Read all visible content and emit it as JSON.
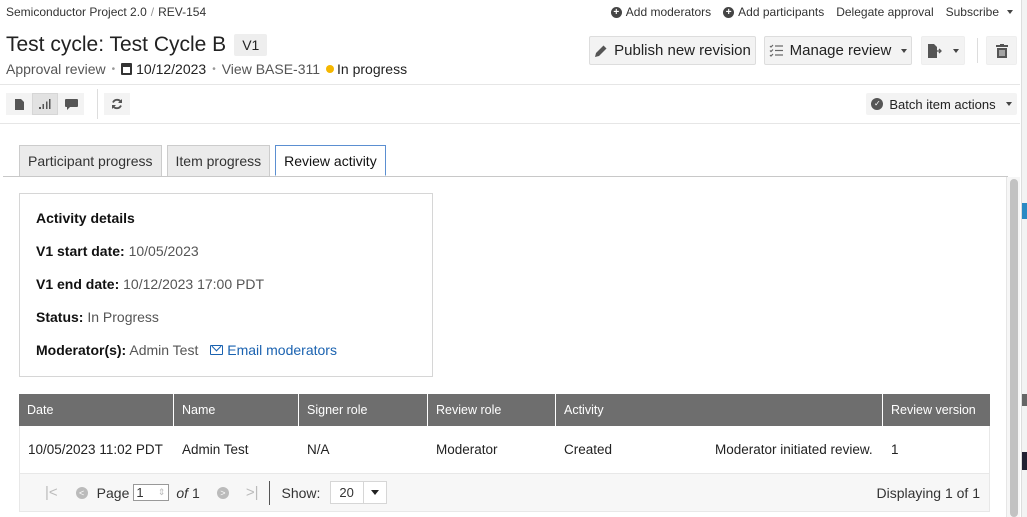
{
  "breadcrumb": {
    "project": "Semiconductor Project 2.0",
    "separator": "/",
    "item": "REV-154"
  },
  "top_links": {
    "add_moderators": "Add moderators",
    "add_participants": "Add participants",
    "delegate_approval": "Delegate approval",
    "subscribe": "Subscribe"
  },
  "header": {
    "title": "Test cycle: Test Cycle B",
    "version_badge": "V1",
    "review_type": "Approval review",
    "due_date": "10/12/2023",
    "view_link": "View BASE-311",
    "status": "In progress",
    "status_color": "#f5b700"
  },
  "actions": {
    "publish": "Publish new revision",
    "manage": "Manage review"
  },
  "toolbar": {
    "icons": [
      "document-icon",
      "progress-bars-icon",
      "comment-icon"
    ],
    "active_view": "progress-bars-icon",
    "batch_actions": "Batch item actions"
  },
  "tabs": [
    {
      "label": "Participant progress",
      "active": false
    },
    {
      "label": "Item progress",
      "active": false
    },
    {
      "label": "Review activity",
      "active": true
    }
  ],
  "details": {
    "heading": "Activity details",
    "start_label": "V1 start date:",
    "start_value": "10/05/2023",
    "end_label": "V1 end date:",
    "end_value": "10/12/2023 17:00 PDT",
    "status_label": "Status:",
    "status_value": "In Progress",
    "moderators_label": "Moderator(s):",
    "moderators_value": "Admin Test",
    "email_link": "Email moderators",
    "link_color": "#1a62b0"
  },
  "table": {
    "columns": [
      "Date",
      "Name",
      "Signer role",
      "Review role",
      "Activity",
      "Review version"
    ],
    "rows": [
      {
        "date": "10/05/2023 11:02 PDT",
        "name": "Admin Test",
        "signer_role": "N/A",
        "review_role": "Moderator",
        "activity": "Created",
        "activity_detail": "Moderator initiated review.",
        "review_version": "1"
      }
    ]
  },
  "pager": {
    "page_label": "Page",
    "page_value": "1",
    "of_label": "of",
    "total_pages": "1",
    "show_label": "Show:",
    "show_value": "20",
    "displaying": "Displaying 1 of 1"
  }
}
